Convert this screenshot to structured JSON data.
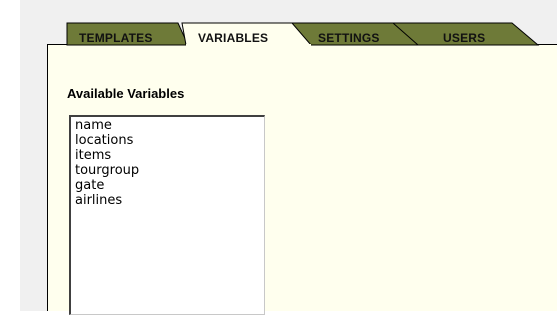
{
  "tabs": [
    {
      "label": "TEMPLATES",
      "active": false
    },
    {
      "label": "VARIABLES",
      "active": true
    },
    {
      "label": "SETTINGS",
      "active": false
    },
    {
      "label": "USERS",
      "active": false
    }
  ],
  "colors": {
    "inactive_tab": "#6e7a38",
    "active_tab": "#ffffee",
    "panel_bg": "#ffffee"
  },
  "variables_panel": {
    "title": "Available Variables",
    "items": [
      "name",
      "locations",
      "items",
      "tourgroup",
      "gate",
      "airlines"
    ]
  }
}
